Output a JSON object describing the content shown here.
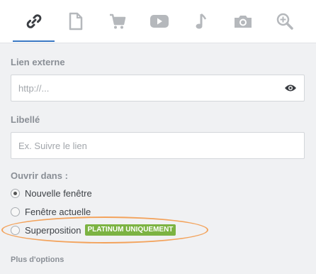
{
  "tabs": [
    {
      "icon": "link-icon",
      "active": true
    },
    {
      "icon": "document-icon",
      "active": false
    },
    {
      "icon": "cart-icon",
      "active": false
    },
    {
      "icon": "youtube-icon",
      "active": false
    },
    {
      "icon": "music-note-icon",
      "active": false
    },
    {
      "icon": "camera-icon",
      "active": false
    },
    {
      "icon": "zoom-in-icon",
      "active": false
    }
  ],
  "external_link": {
    "label": "Lien externe",
    "placeholder": "http://...",
    "value": "",
    "preview_icon": "eye-icon"
  },
  "link_label": {
    "label": "Libellé",
    "placeholder": "Ex. Suivre le lien",
    "value": ""
  },
  "open_in": {
    "label": "Ouvrir dans :",
    "options": [
      {
        "label": "Nouvelle fenêtre",
        "checked": true
      },
      {
        "label": "Fenêtre actuelle",
        "checked": false
      },
      {
        "label": "Superposition",
        "checked": false,
        "badge": "PLATINUM UNIQUEMENT"
      }
    ]
  },
  "more_options": "Plus d'options",
  "colors": {
    "accent": "#3a78c3",
    "badge": "#7cb342",
    "highlight": "#f3a35c",
    "icon": "#b5b8bc"
  }
}
